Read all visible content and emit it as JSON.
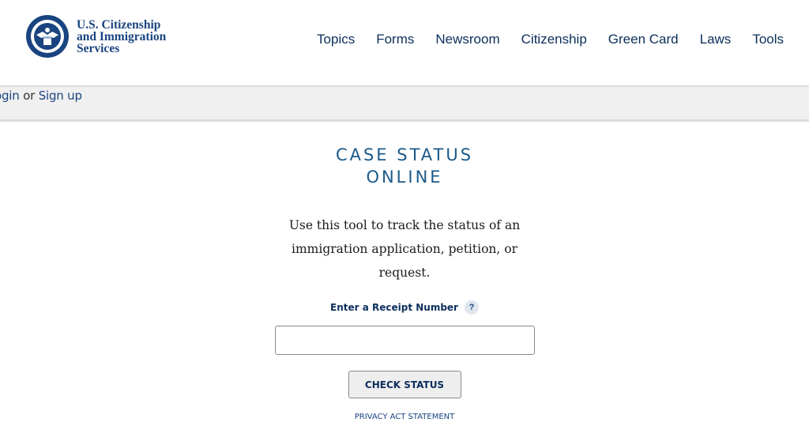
{
  "header": {
    "agency_line1": "U.S. Citizenship",
    "agency_line2": "and Immigration",
    "agency_line3": "Services",
    "seal_icon": "dhs-seal-icon",
    "nav": [
      {
        "label": "Topics"
      },
      {
        "label": "Forms"
      },
      {
        "label": "Newsroom"
      },
      {
        "label": "Citizenship"
      },
      {
        "label": "Green Card"
      },
      {
        "label": "Laws"
      },
      {
        "label": "Tools"
      }
    ]
  },
  "userbar": {
    "login": "ogin",
    "or": "or",
    "signup": "Sign up"
  },
  "main": {
    "title_line1": "CASE STATUS",
    "title_line2": "ONLINE",
    "description": "Use this tool to track the status of an immigration application, petition, or request.",
    "receipt_label": "Enter a Receipt Number",
    "help_icon": "?",
    "receipt_value": "",
    "check_button": "CHECK STATUS",
    "privacy_link": "PRIVACY ACT STATEMENT"
  },
  "colors": {
    "brand_navy": "#1a4480",
    "title_blue": "#1a5a8a",
    "nav_text": "#0b2e5b"
  }
}
